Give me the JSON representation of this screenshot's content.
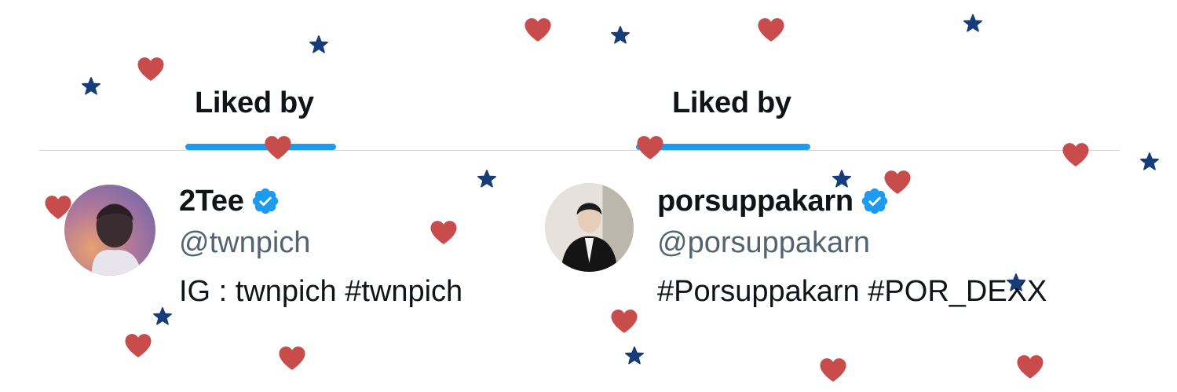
{
  "colors": {
    "accent": "#1d9bf0",
    "divider": "#cfd9de",
    "heart": "#c84c4c",
    "star": "#173c7a",
    "verified": "#1d9bf0"
  },
  "panels": [
    {
      "tab": {
        "label": "Liked by"
      },
      "user": {
        "display_name": "2Tee",
        "handle": "@twnpich",
        "bio": "IG : twnpich #twnpich",
        "verified": true
      }
    },
    {
      "tab": {
        "label": "Liked by"
      },
      "user": {
        "display_name": "porsuppakarn",
        "handle": "@porsuppakarn",
        "bio": "#Porsuppakarn #POR_DEXX",
        "verified": true
      }
    }
  ],
  "decorations": {
    "heart_icon": "heart-icon",
    "star_icon": "star-icon"
  }
}
